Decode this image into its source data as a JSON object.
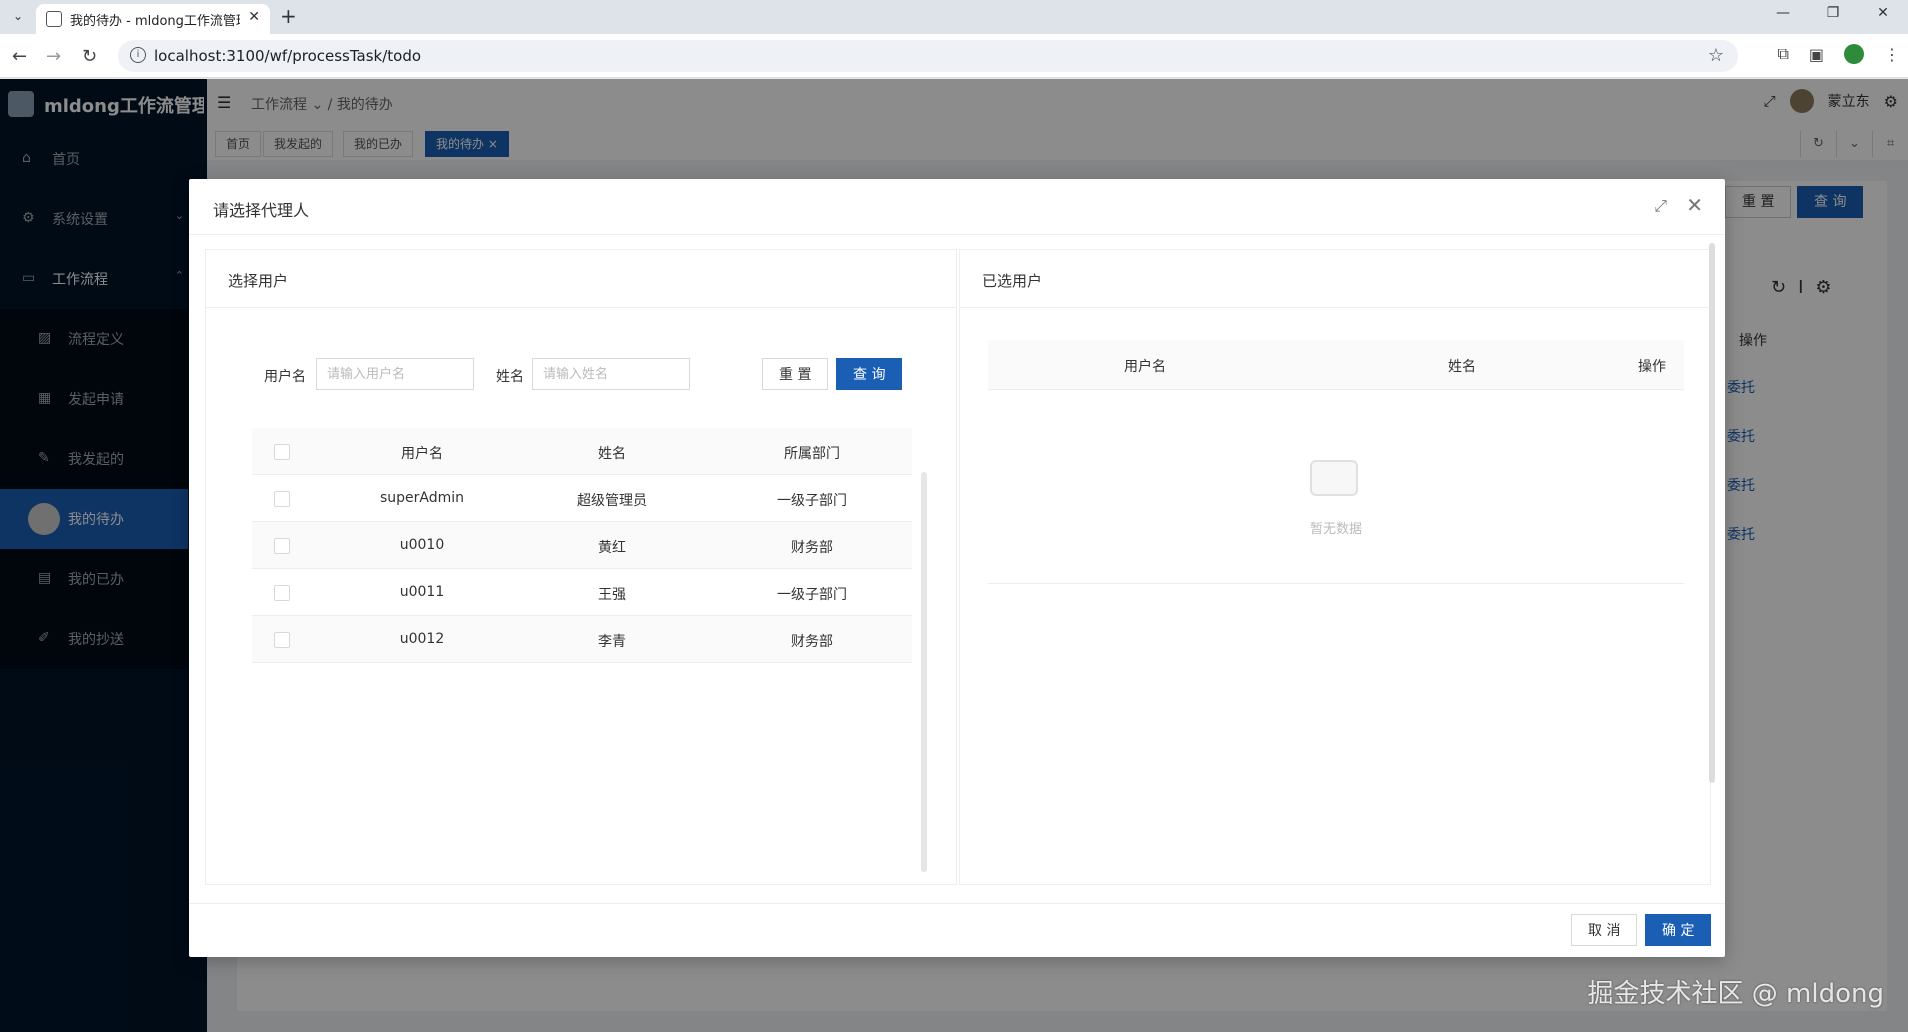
{
  "browser": {
    "tab_title": "我的待办 - mldong工作流管理",
    "url": "localhost:3100/wf/processTask/todo"
  },
  "app": {
    "logo_text": "mldong工作流管理...",
    "breadcrumb_parent": "工作流程",
    "breadcrumb_current": "我的待办",
    "user_name": "蒙立东"
  },
  "sidebar": {
    "items": [
      {
        "label": "首页",
        "icon": "home-icon"
      },
      {
        "label": "系统设置",
        "icon": "gear-icon"
      },
      {
        "label": "工作流程",
        "icon": "monitor-icon"
      },
      {
        "label": "流程定义",
        "icon": "image-icon"
      },
      {
        "label": "发起申请",
        "icon": "grid-icon"
      },
      {
        "label": "我发起的",
        "icon": "edit-icon"
      },
      {
        "label": "我的待办",
        "icon": "avatar-icon"
      },
      {
        "label": "我的已办",
        "icon": "list-icon"
      },
      {
        "label": "我的抄送",
        "icon": "pen-icon"
      }
    ]
  },
  "app_tabs": [
    {
      "label": "首页"
    },
    {
      "label": "我发起的"
    },
    {
      "label": "我的已办"
    },
    {
      "label": "我的待办"
    }
  ],
  "background_page": {
    "reset_label": "重 置",
    "query_label": "查 询",
    "action_header": "操作",
    "delegate_label": "委托"
  },
  "modal": {
    "title": "请选择代理人",
    "left_panel_title": "选择用户",
    "right_panel_title": "已选用户",
    "search": {
      "username_label": "用户名",
      "username_placeholder": "请输入用户名",
      "name_label": "姓名",
      "name_placeholder": "请输入姓名",
      "reset_label": "重 置",
      "query_label": "查 询"
    },
    "user_table": {
      "columns": [
        "用户名",
        "姓名",
        "所属部门"
      ],
      "rows": [
        {
          "username": "superAdmin",
          "name": "超级管理员",
          "dept": "一级子部门"
        },
        {
          "username": "u0010",
          "name": "黄红",
          "dept": "财务部"
        },
        {
          "username": "u0011",
          "name": "王强",
          "dept": "一级子部门"
        },
        {
          "username": "u0012",
          "name": "李青",
          "dept": "财务部"
        }
      ]
    },
    "selected_table": {
      "columns": [
        "用户名",
        "姓名",
        "操作"
      ],
      "empty_text": "暂无数据"
    },
    "footer": {
      "cancel_label": "取 消",
      "confirm_label": "确 定"
    }
  },
  "watermark": "掘金技术社区 @ mldong"
}
